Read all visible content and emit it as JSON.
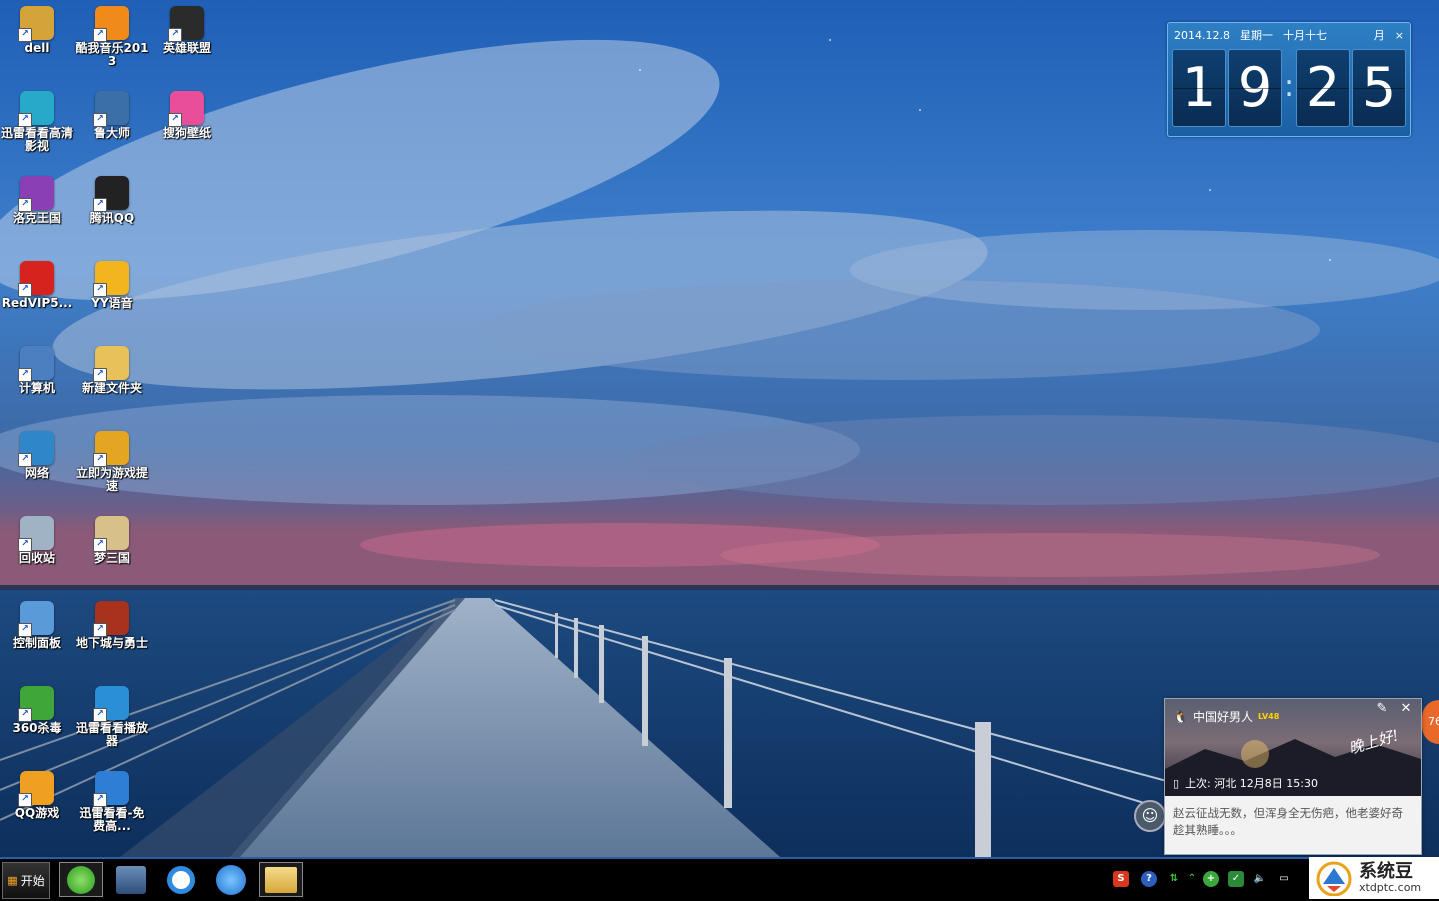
{
  "desktop": {
    "icons": [
      {
        "label": "dell",
        "icon": "user-folder-icon",
        "color": "#d4a43a"
      },
      {
        "label": "酷我音乐2013",
        "icon": "kuwo-music-icon",
        "color": "#f08a1a"
      },
      {
        "label": "英雄联盟",
        "icon": "league-of-legends-icon",
        "color": "#2b2b2b"
      },
      {
        "label": "迅雷看看高清影视",
        "icon": "xunlei-kankan-icon",
        "color": "#27a9c9"
      },
      {
        "label": "鲁大师",
        "icon": "ludashi-icon",
        "color": "#3a6fa8"
      },
      {
        "label": "搜狗壁纸",
        "icon": "sogou-wallpaper-icon",
        "color": "#e94e9a"
      },
      {
        "label": "洛克王国",
        "icon": "roco-kingdom-icon",
        "color": "#8a3fb5"
      },
      {
        "label": "腾讯QQ",
        "icon": "qq-penguin-icon",
        "color": "#222222"
      },
      {
        "label": "RedVIP5...",
        "icon": "redvip-icon",
        "color": "#d6231e"
      },
      {
        "label": "YY语音",
        "icon": "yy-voice-icon",
        "color": "#f2b51d"
      },
      {
        "label": "计算机",
        "icon": "computer-icon",
        "color": "#4c7fbf"
      },
      {
        "label": "新建文件夹",
        "icon": "folder-icon",
        "color": "#e8c15a"
      },
      {
        "label": "网络",
        "icon": "network-icon",
        "color": "#2f86c9"
      },
      {
        "label": "立即为游戏提速",
        "icon": "game-boost-icon",
        "color": "#e4a520"
      },
      {
        "label": "回收站",
        "icon": "recycle-bin-icon",
        "color": "#9fb3c4"
      },
      {
        "label": "梦三国",
        "icon": "meng-sanguo-icon",
        "color": "#d8c08a"
      },
      {
        "label": "控制面板",
        "icon": "control-panel-icon",
        "color": "#5a9ad8"
      },
      {
        "label": "地下城与勇士",
        "icon": "dnf-icon",
        "color": "#a8321e"
      },
      {
        "label": "360杀毒",
        "icon": "360-antivirus-icon",
        "color": "#3fa63a"
      },
      {
        "label": "迅雷看看播放器",
        "icon": "xunlei-player-icon",
        "color": "#2a8fd6"
      },
      {
        "label": "QQ游戏",
        "icon": "qq-game-icon",
        "color": "#f0a020"
      },
      {
        "label": "迅雷看看-免费高...",
        "icon": "xunlei-free-icon",
        "color": "#2d7ed4"
      }
    ]
  },
  "clock_widget": {
    "date": "2014.12.8",
    "weekday": "星期一",
    "lunar": "十月十七",
    "month_button": "月",
    "close": "×",
    "h1": "1",
    "h2": "9",
    "m1": "2",
    "m2": "5"
  },
  "qq_popup": {
    "name": "中国好男人",
    "level": "LV48",
    "greeting": "晚上好!",
    "last_login": "上次: 河北  12月8日 15:30",
    "message": "赵云征战无数，但浑身全无伤疤，他老婆好奇趁其熟睡。。。",
    "edit_icon": "✎",
    "close_icon": "✕"
  },
  "side_badge": "76",
  "taskbar": {
    "start_label": "开始",
    "apps": [
      "green-browser-icon",
      "media-library-icon",
      "qq-browser-icon",
      "tencent-media-icon",
      "explorer-folder-icon"
    ],
    "tray_icons": [
      "sogou-input-icon",
      "help-icon",
      "network-status-icon",
      "expand-tray-icon",
      "360-guard-icon",
      "shield-icon",
      "volume-icon",
      "action-center-icon"
    ]
  },
  "watermark": {
    "title": "系统豆",
    "url": "xtdptc.com"
  }
}
